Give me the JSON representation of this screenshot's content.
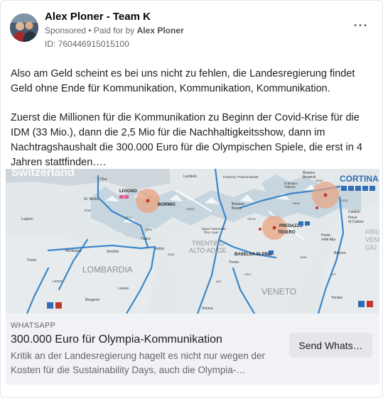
{
  "post": {
    "author": "Alex Ploner - Team K",
    "sponsored_label": "Sponsored",
    "separator": " • ",
    "paid_for_by": "Paid for by",
    "payer": "Alex Ploner",
    "ad_id": "ID: 760446915015100",
    "more_icon": "more-horizontal-icon",
    "paragraphs": [
      "Also am Geld scheint es bei uns nicht zu fehlen, die Landesregierung findet Geld ohne Ende für Kommunikation, Kommunikation, Kommunikation.",
      "Zuerst die Millionen für die Kommunikation zu Beginn der Covid-Krise für die IDM (33 Mio.), dann die 2,5 Mio für die Nachhaltigkeitsshow, dann im Nachtragshaushalt die 300.000 Euro für die Olympischen Spiele, die erst in 4 Jahren stattfinden…."
    ]
  },
  "map": {
    "labels": {
      "switzerland": "Switzerland",
      "livigno": "LIVIGNO",
      "bormio": "BORMIO",
      "cortina": "CORTINA",
      "predazzo": "PREDAZZO",
      "tesero": "TESERO",
      "trentino": "TRENTINO",
      "alto_adige": "ALTO ADIGE",
      "lombardia": "LOMBARDIA",
      "veneto": "VENETO",
      "friuli": "FRIU",
      "venezia": "VENE",
      "giulia": "GIU",
      "baselga": "BASELGA DI PINÈ",
      "bolzano": "Bolzano",
      "bozen": "Bozen",
      "trento": "Trento",
      "verona": "Verona",
      "treviso": "Treviso",
      "lecco": "Lecco",
      "tirano": "Tirano",
      "edolo": "Edolo",
      "chur": "Chur",
      "st_moritz": "St. Moritz",
      "sondrio": "Sondrio",
      "brunico": "Brunico",
      "bruneck": "Bruneck",
      "calalzo": "Calalzo",
      "pieve": "Pieve",
      "cadore": "di Cadore",
      "ponte": "Ponte",
      "nelle_alpi": "nelle Alpi",
      "fortezza": "Fortezza / Franzensfeste",
      "egna": "Egna / Neumarkt",
      "ora": "Ora / Auer",
      "morbegno": "Morbegno",
      "bergamo": "Bergamo",
      "lovere": "Lovere",
      "lugano": "Lugano",
      "como": "Como",
      "landeck": "Landeck",
      "dobbiaco": "Dobbiaco",
      "toblach": "Toblach",
      "belluno": "Belluno",
      "ss36": "SS36",
      "ss38": "SS38",
      "ss39": "SS39",
      "ss42": "SS42",
      "ss47": "SS47",
      "ss48": "SS48",
      "ss49": "SS49",
      "ss50": "SS50",
      "ss51": "SS51",
      "ss241": "SS241",
      "ss301": "SS301",
      "a22": "A22",
      "a27": "A27"
    }
  },
  "link": {
    "domain": "WHATSAPP",
    "title": "300.000 Euro für Olympia-Kommunikation",
    "description": "Kritik an der Landesregierung hagelt es nicht nur wegen der Kosten für die Sustainability Days, auch die Olympia-…",
    "cta_label": "Send Whats…"
  },
  "colors": {
    "accent": "#1877f2",
    "secondary_text": "#65676b",
    "cta_bg": "#e4e6eb",
    "link_bar_bg": "#f0f2f5",
    "venue_circle": "#e8a27f",
    "route_blue": "#3b86c8",
    "cortina_blue": "#2f6db5"
  }
}
